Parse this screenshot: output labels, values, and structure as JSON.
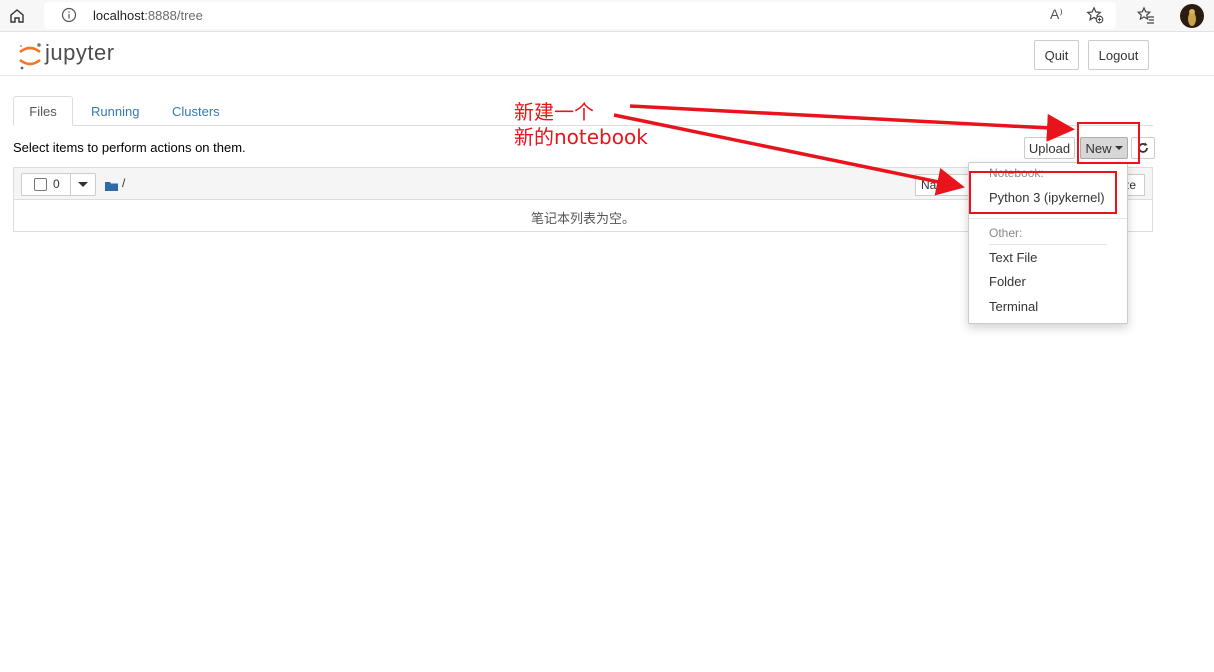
{
  "browser": {
    "url_host": "localhost",
    "url_rest": ":8888/tree",
    "read_aloud_glyph": "A⁾"
  },
  "header": {
    "logo_text": "jupyter",
    "quit_label": "Quit",
    "logout_label": "Logout"
  },
  "tabs": [
    {
      "label": "Files",
      "active": true
    },
    {
      "label": "Running",
      "active": false
    },
    {
      "label": "Clusters",
      "active": false
    }
  ],
  "toolbar": {
    "hint": "Select items to perform actions on them.",
    "upload_label": "Upload",
    "new_label": "New"
  },
  "file_list": {
    "selected_count": "0",
    "breadcrumb": "/",
    "sort_name_label": "Name",
    "sort_size_label": "Size",
    "empty_message": "笔记本列表为空。"
  },
  "new_menu": {
    "notebook_header": "Notebook:",
    "python_kernel": "Python 3 (ipykernel)",
    "other_header": "Other:",
    "text_file": "Text File",
    "folder": "Folder",
    "terminal": "Terminal"
  },
  "annotation": {
    "line1": "新建一个",
    "line2": "新的notebook",
    "color": "#e8131b"
  },
  "colors": {
    "link": "#337ab7",
    "jupyter_orange": "#f37726"
  }
}
